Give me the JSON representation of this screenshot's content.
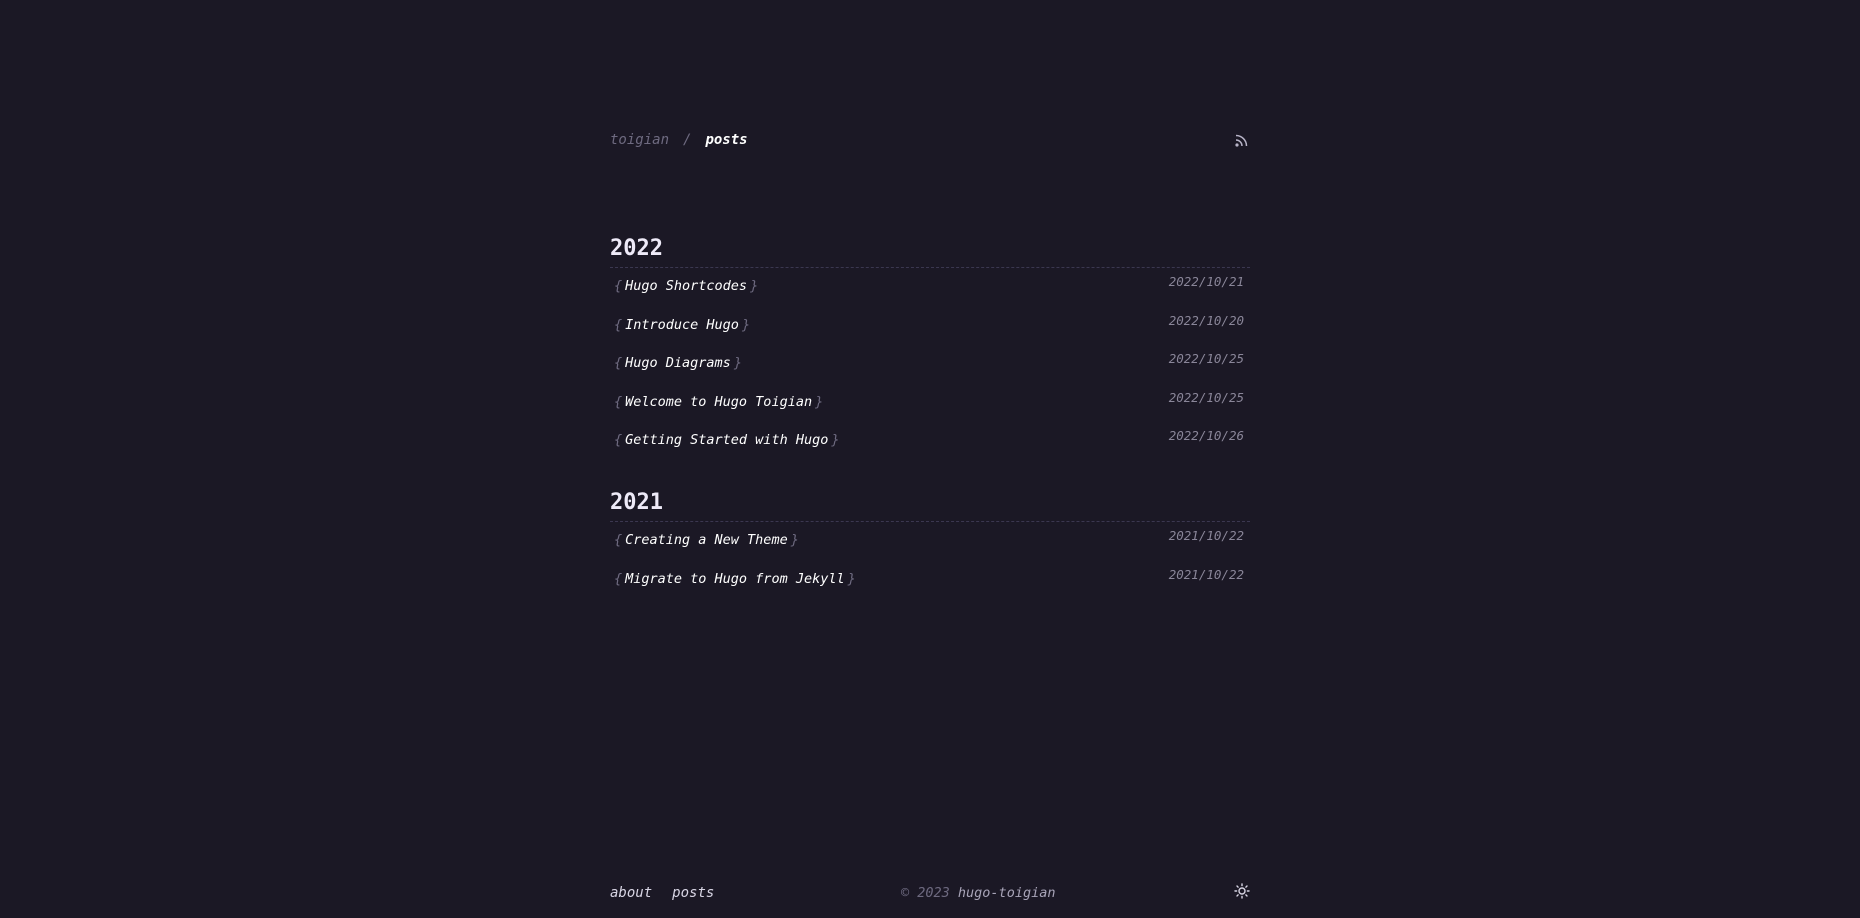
{
  "header": {
    "home_label": "toigian",
    "separator": "/",
    "current_label": "posts",
    "rss_icon": "rss-icon"
  },
  "years": [
    {
      "year": "2022",
      "posts": [
        {
          "title": "Hugo Shortcodes",
          "date": "2022/10/21"
        },
        {
          "title": "Introduce Hugo",
          "date": "2022/10/20"
        },
        {
          "title": "Hugo Diagrams",
          "date": "2022/10/25"
        },
        {
          "title": "Welcome to Hugo Toigian",
          "date": "2022/10/25"
        },
        {
          "title": "Getting Started with Hugo",
          "date": "2022/10/26"
        }
      ]
    },
    {
      "year": "2021",
      "posts": [
        {
          "title": "Creating a New Theme",
          "date": "2021/10/22"
        },
        {
          "title": "Migrate to Hugo from Jekyll",
          "date": "2021/10/22"
        }
      ]
    }
  ],
  "braces": {
    "open": "{",
    "close": "}"
  },
  "footer": {
    "nav": [
      {
        "label": "about"
      },
      {
        "label": "posts"
      }
    ],
    "copyright_prefix": "© 2023",
    "copyright_name": "hugo-toigian",
    "theme_icon": "sun-icon"
  },
  "colors": {
    "background": "#1b1825",
    "text": "#ffffff",
    "muted": "#6e6a80",
    "date": "#8a8699"
  }
}
